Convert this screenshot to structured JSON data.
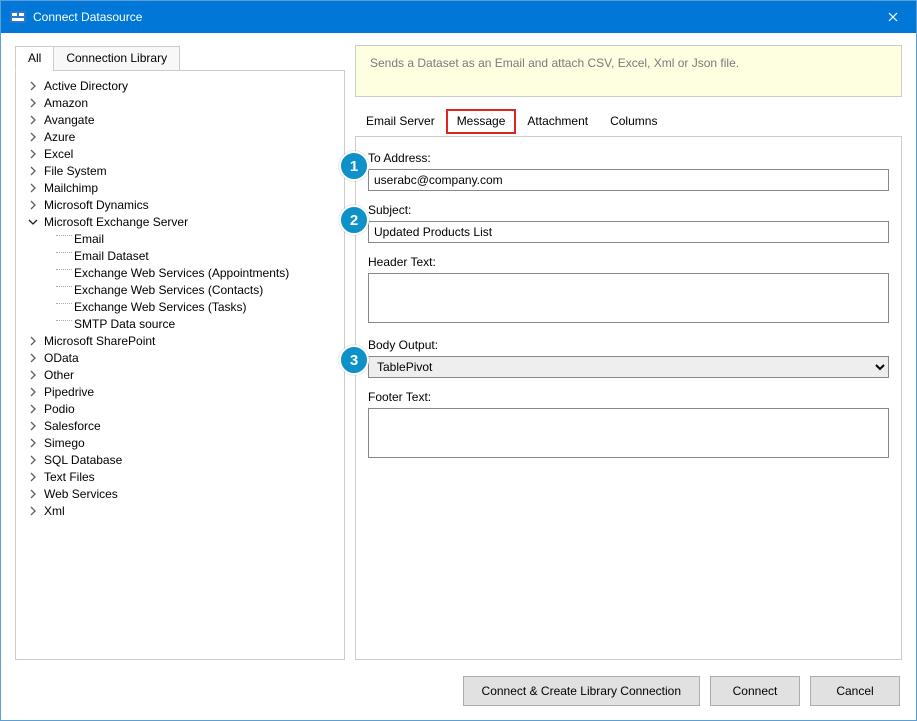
{
  "title": "Connect Datasource",
  "leftTabs": {
    "all": "All",
    "library": "Connection Library"
  },
  "tree": {
    "items": [
      "Active Directory",
      "Amazon",
      "Avangate",
      "Azure",
      "Excel",
      "File System",
      "Mailchimp",
      "Microsoft Dynamics"
    ],
    "expandedLabel": "Microsoft Exchange Server",
    "children": [
      "Email",
      "Email Dataset",
      "Exchange Web Services (Appointments)",
      "Exchange Web Services (Contacts)",
      "Exchange Web Services (Tasks)",
      "SMTP Data source"
    ],
    "itemsAfter": [
      "Microsoft SharePoint",
      "OData",
      "Other",
      "Pipedrive",
      "Podio",
      "Salesforce",
      "Simego",
      "SQL Database",
      "Text Files",
      "Web Services",
      "Xml"
    ]
  },
  "hint": "Sends a Dataset as an Email and attach CSV, Excel, Xml or Json file.",
  "rightTabs": [
    "Email Server",
    "Message",
    "Attachment",
    "Columns"
  ],
  "selectedRightTab": 1,
  "form": {
    "toLabel": "To Address:",
    "toValue": "userabc@company.com",
    "subjectLabel": "Subject:",
    "subjectValue": "Updated Products List",
    "headerLabel": "Header Text:",
    "headerValue": "",
    "bodyLabel": "Body Output:",
    "bodyValue": "TablePivot",
    "footerLabel": "Footer Text:",
    "footerValue": ""
  },
  "buttons": {
    "createLib": "Connect & Create Library Connection",
    "connect": "Connect",
    "cancel": "Cancel"
  },
  "markers": [
    "1",
    "2",
    "3"
  ]
}
